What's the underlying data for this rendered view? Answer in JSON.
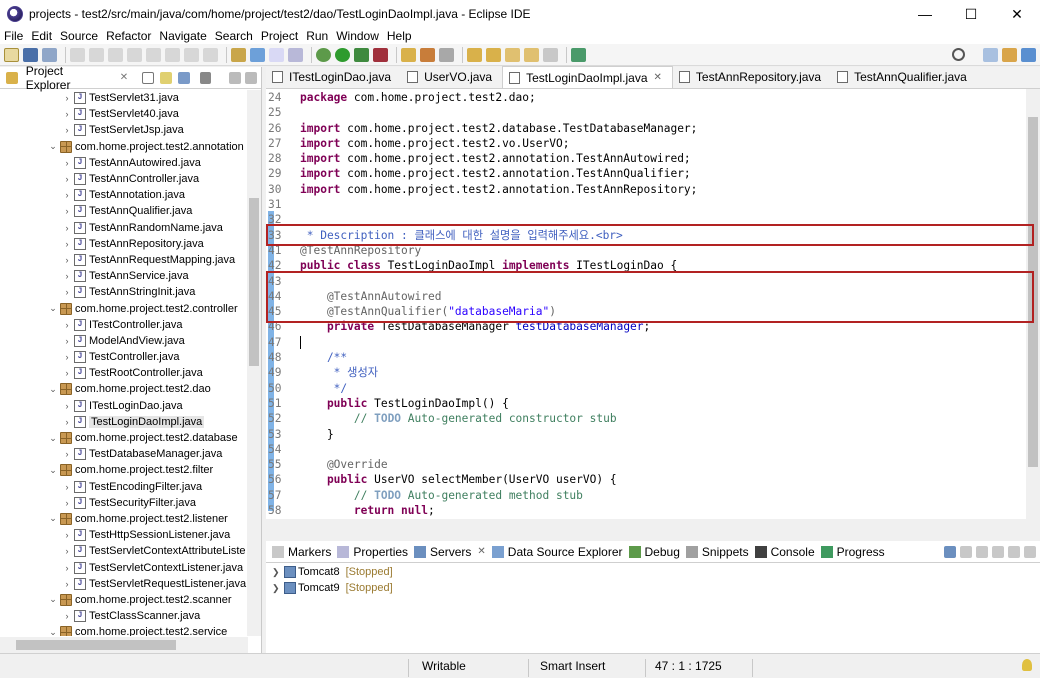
{
  "window": {
    "title": "projects - test2/src/main/java/com/home/project/test2/dao/TestLoginDaoImpl.java - Eclipse IDE",
    "minimize": "—",
    "maximize": "☐",
    "close": "✕"
  },
  "menu": [
    "File",
    "Edit",
    "Source",
    "Refactor",
    "Navigate",
    "Search",
    "Project",
    "Run",
    "Window",
    "Help"
  ],
  "explorer": {
    "title": "Project Explorer",
    "close": "✕",
    "items": [
      {
        "kind": "file",
        "label": "TestServlet31.java",
        "indent": 2
      },
      {
        "kind": "file",
        "label": "TestServlet40.java",
        "indent": 2
      },
      {
        "kind": "file",
        "label": "TestServletJsp.java",
        "indent": 2
      },
      {
        "kind": "package",
        "label": "com.home.project.test2.annotation",
        "indent": 1
      },
      {
        "kind": "file",
        "label": "TestAnnAutowired.java",
        "indent": 2
      },
      {
        "kind": "file",
        "label": "TestAnnController.java",
        "indent": 2
      },
      {
        "kind": "file",
        "label": "TestAnnotation.java",
        "indent": 2
      },
      {
        "kind": "file",
        "label": "TestAnnQualifier.java",
        "indent": 2
      },
      {
        "kind": "file",
        "label": "TestAnnRandomName.java",
        "indent": 2
      },
      {
        "kind": "file",
        "label": "TestAnnRepository.java",
        "indent": 2
      },
      {
        "kind": "file",
        "label": "TestAnnRequestMapping.java",
        "indent": 2
      },
      {
        "kind": "file",
        "label": "TestAnnService.java",
        "indent": 2
      },
      {
        "kind": "file",
        "label": "TestAnnStringInit.java",
        "indent": 2
      },
      {
        "kind": "package",
        "label": "com.home.project.test2.controller",
        "indent": 1
      },
      {
        "kind": "file",
        "label": "ITestController.java",
        "indent": 2
      },
      {
        "kind": "file",
        "label": "ModelAndView.java",
        "indent": 2
      },
      {
        "kind": "file",
        "label": "TestController.java",
        "indent": 2
      },
      {
        "kind": "file",
        "label": "TestRootController.java",
        "indent": 2
      },
      {
        "kind": "package",
        "label": "com.home.project.test2.dao",
        "indent": 1
      },
      {
        "kind": "file",
        "label": "ITestLoginDao.java",
        "indent": 2
      },
      {
        "kind": "file",
        "label": "TestLoginDaoImpl.java",
        "indent": 2,
        "selected": true
      },
      {
        "kind": "package",
        "label": "com.home.project.test2.database",
        "indent": 1
      },
      {
        "kind": "file",
        "label": "TestDatabaseManager.java",
        "indent": 2
      },
      {
        "kind": "package",
        "label": "com.home.project.test2.filter",
        "indent": 1
      },
      {
        "kind": "file",
        "label": "TestEncodingFilter.java",
        "indent": 2
      },
      {
        "kind": "file",
        "label": "TestSecurityFilter.java",
        "indent": 2
      },
      {
        "kind": "package",
        "label": "com.home.project.test2.listener",
        "indent": 1
      },
      {
        "kind": "file",
        "label": "TestHttpSessionListener.java",
        "indent": 2
      },
      {
        "kind": "file",
        "label": "TestServletContextAttributeListe",
        "indent": 2
      },
      {
        "kind": "file",
        "label": "TestServletContextListener.java",
        "indent": 2
      },
      {
        "kind": "file",
        "label": "TestServletRequestListener.java",
        "indent": 2
      },
      {
        "kind": "package",
        "label": "com.home.project.test2.scanner",
        "indent": 1
      },
      {
        "kind": "file",
        "label": "TestClassScanner.java",
        "indent": 2
      },
      {
        "kind": "package",
        "label": "com.home.project.test2.service",
        "indent": 1
      }
    ]
  },
  "editor_tabs": [
    {
      "label": "ITestLoginDao.java",
      "active": false
    },
    {
      "label": "UserVO.java",
      "active": false
    },
    {
      "label": "TestLoginDaoImpl.java",
      "active": true,
      "close": "✕"
    },
    {
      "label": "TestAnnRepository.java",
      "active": false
    },
    {
      "label": "TestAnnQualifier.java",
      "active": false
    }
  ],
  "code": {
    "line_numbers": [
      "24",
      "25",
      "26",
      "27",
      "28",
      "29",
      "30",
      "31",
      "32",
      "33",
      "41",
      "42",
      "43",
      "44",
      "45",
      "46",
      "47",
      "48",
      "49",
      "50",
      "51",
      "52",
      "53",
      "54",
      "55",
      "56",
      "57",
      "58",
      "59"
    ],
    "l24_kw": "package",
    "l24_rest": " com.home.project.test2.dao;",
    "l26_kw": "import",
    "l26_rest": " com.home.project.test2.database.TestDatabaseManager;",
    "l27_kw": "import",
    "l27_rest": " com.home.project.test2.vo.UserVO;",
    "l28_kw": "import",
    "l28_rest": " com.home.project.test2.annotation.TestAnnAutowired;",
    "l29_kw": "import",
    "l29_rest": " com.home.project.test2.annotation.TestAnnQualifier;",
    "l30_kw": "import",
    "l30_rest": " com.home.project.test2.annotation.TestAnnRepository;",
    "l33_text": " * Description : 클래스에 대한 설명을 입력해주세요.<br>",
    "l41_ann": "@TestAnnRepository",
    "l42_kw1": "public class",
    "l42_name": " TestLoginDaoImpl ",
    "l42_kw2": "implements",
    "l42_rest": " ITestLoginDao {",
    "l44_ann": "    @TestAnnAutowired",
    "l45_ann": "    @TestAnnQualifier(",
    "l45_str": "\"databaseMaria\"",
    "l45_end": ")",
    "l46_kw": "    private",
    "l46_type": " TestDatabaseManager ",
    "l46_field": "testDatabaseManager",
    "l46_end": ";",
    "l48_text": "    /**",
    "l49_text": "     * 생성자",
    "l50_text": "     */",
    "l51_kw": "    public",
    "l51_rest": " TestLoginDaoImpl() {",
    "l52_pre": "        // ",
    "l52_todo": "TODO",
    "l52_rest": " Auto-generated constructor stub",
    "l53_text": "    }",
    "l55_ann": "    @Override",
    "l56_kw": "    public",
    "l56_rest": " UserVO selectMember(UserVO ",
    "l56_param": "userVO",
    "l56_end": ") {",
    "l57_pre": "        // ",
    "l57_todo": "TODO",
    "l57_rest": " Auto-generated method stub",
    "l58_kw": "        return null",
    "l58_end": ";",
    "l59_text": "    }"
  },
  "bottom_tabs": [
    {
      "label": "Markers",
      "icon": "markers-icon"
    },
    {
      "label": "Properties",
      "icon": "properties-icon"
    },
    {
      "label": "Servers",
      "icon": "servers-icon",
      "active": true,
      "close": "✕"
    },
    {
      "label": "Data Source Explorer",
      "icon": "data-source-icon"
    },
    {
      "label": "Debug",
      "icon": "debug-icon"
    },
    {
      "label": "Snippets",
      "icon": "snippets-icon"
    },
    {
      "label": "Console",
      "icon": "console-icon"
    },
    {
      "label": "Progress",
      "icon": "progress-icon"
    }
  ],
  "servers": [
    {
      "name": "Tomcat8",
      "status": "[Stopped]"
    },
    {
      "name": "Tomcat9",
      "status": "[Stopped]"
    }
  ],
  "status": {
    "writable": "Writable",
    "insert": "Smart Insert",
    "position": "47 : 1 : 1725"
  },
  "colors": {
    "highlight_box": "#b22222",
    "keyword": "#7f0055",
    "string": "#2a00ff",
    "comment": "#3f7f5f",
    "annotation": "#646464"
  }
}
